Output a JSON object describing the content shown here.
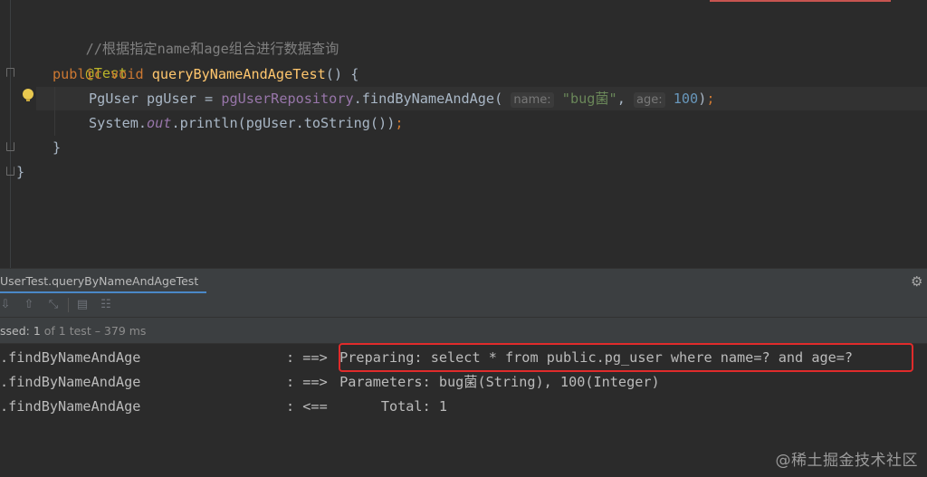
{
  "editor": {
    "comment": "//根据指定name和age组合进行数据查询",
    "annotation": "@Test",
    "line3": {
      "kw_public": "public",
      "kw_void": "void",
      "method": "queryByNameAndAgeTest",
      "rest": "() {"
    },
    "line4": {
      "type": "PgUser",
      "var": " pgUser = ",
      "repo": "pgUserRepository",
      "dot": ".",
      "call": "findByNameAndAge(",
      "hint_name": "name:",
      "arg_name": "\"bug菌\"",
      "comma": ", ",
      "hint_age": "age:",
      "arg_age": "100",
      "close": ")",
      "semi": ";"
    },
    "line5": {
      "prefix": "System.",
      "out": "out",
      "rest": ".println(pgUser.toString())",
      "semi": ";"
    },
    "line6": "}",
    "line7": "}"
  },
  "panel": {
    "tab_label": "UserTest.queryByNameAndAgeTest",
    "gear_icon": "gear-icon"
  },
  "status": {
    "passed": "ssed: 1",
    "rest": " of 1 test – 379 ms"
  },
  "console": [
    {
      "source": ".findByNameAndAge",
      "arrow": ": ==>",
      "message": " Preparing: select * from public.pg_user where name=? and age=?"
    },
    {
      "source": ".findByNameAndAge",
      "arrow": ": ==>",
      "message": " Parameters: bug菌(String), 100(Integer)"
    },
    {
      "source": ".findByNameAndAge",
      "arrow": ": <==",
      "message": "      Total: 1"
    }
  ],
  "watermark": "@稀土掘金技术社区",
  "colors": {
    "highlight_box": "#e02b2b",
    "tab_underline": "#4a88c7",
    "keyword": "#cc7832",
    "method": "#ffc66d"
  }
}
